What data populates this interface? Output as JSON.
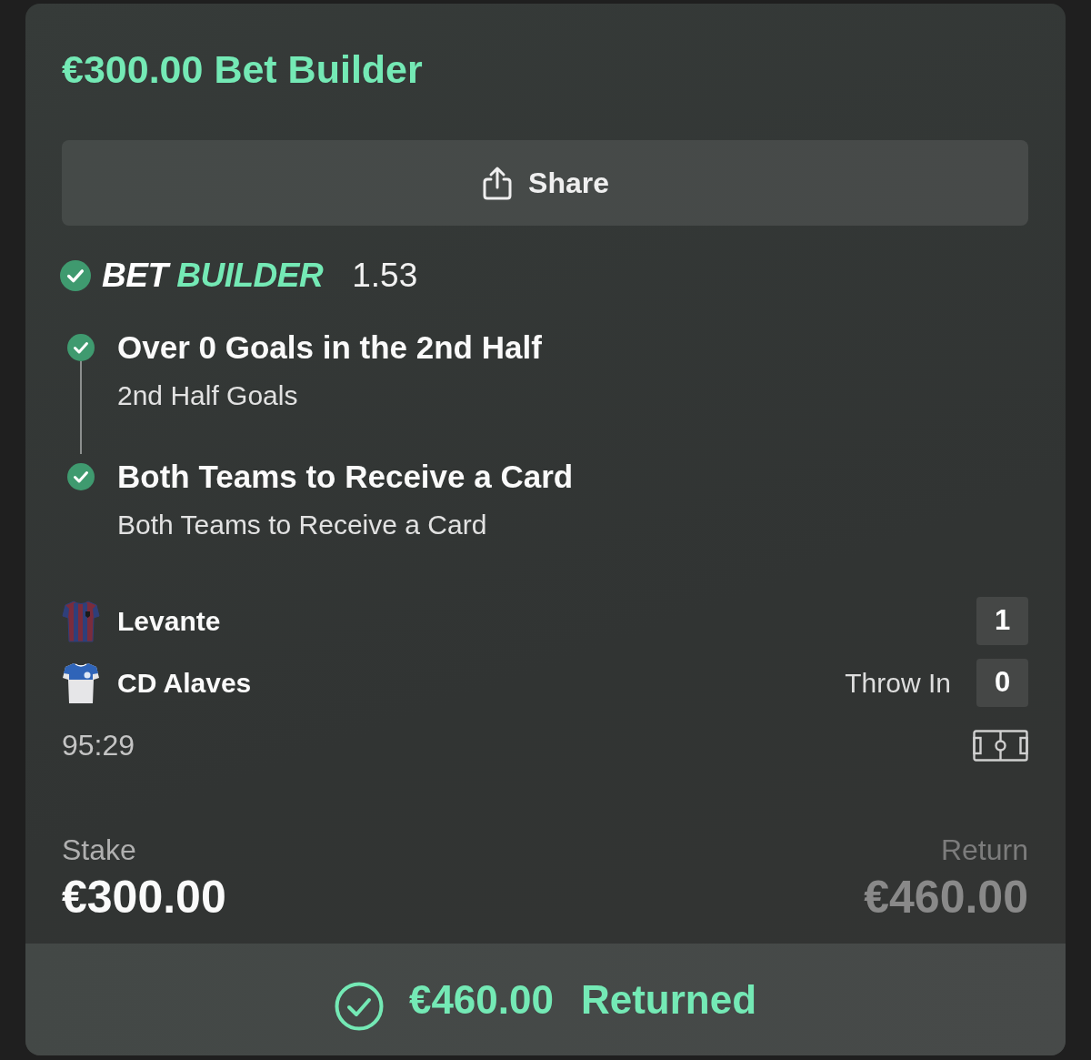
{
  "header": {
    "title": "€300.00 Bet Builder"
  },
  "share_button": {
    "label": "Share"
  },
  "bet_type": {
    "settled": true,
    "parts": [
      {
        "text": "BET",
        "accent": false
      },
      {
        "text": "BUILDER",
        "accent": true
      }
    ],
    "odds": "1.53"
  },
  "legs": [
    {
      "title": "Over 0 Goals in the 2nd Half",
      "market": "2nd Half Goals",
      "won": true
    },
    {
      "title": "Both Teams to Receive a Card",
      "market": "Both Teams to Receive a Card",
      "won": true
    }
  ],
  "match": {
    "teams": [
      {
        "name": "Levante",
        "score": "1"
      },
      {
        "name": "CD Alaves",
        "event": "Throw In",
        "score": "0"
      }
    ],
    "clock": "95:29"
  },
  "stake": {
    "label": "Stake",
    "amount": "€300.00"
  },
  "return": {
    "label": "Return",
    "amount": "€460.00"
  },
  "result": {
    "amount": "€460.00",
    "status": "Returned"
  }
}
